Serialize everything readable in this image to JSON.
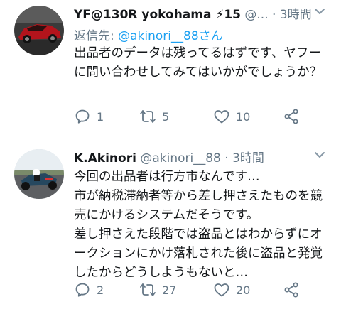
{
  "colors": {
    "link": "#1da1f2",
    "muted": "#657786",
    "text": "#14171a"
  },
  "tweets": [
    {
      "display_name": "YF@130R yokohama ⚡15",
      "handle": "@...",
      "dot": "·",
      "time": "3時間",
      "reply_prefix": "返信先:",
      "reply_mention": "@akinori__88さん",
      "text": "出品者のデータは残ってるはずです、ヤフーに問い合わせしてみてはいかがでしょうか？",
      "replies": "1",
      "retweets": "5",
      "likes": "10",
      "avatar_icon": "red-sports-car-avatar"
    },
    {
      "display_name": "K.Akinori",
      "handle": "@akinori__88",
      "dot": "·",
      "time": "3時間",
      "text": "今回の出品者は行方市なんです…\n市が納税滞納者等から差し押さえたものを競売にかけるシステムだそうです。\n差し押さえた段階では盗品とはわからずにオークションにかけ落札された後に盗品と発覚したからどうしようもないと…",
      "replies": "2",
      "retweets": "27",
      "likes": "20",
      "avatar_icon": "go-kart-avatar"
    }
  ]
}
